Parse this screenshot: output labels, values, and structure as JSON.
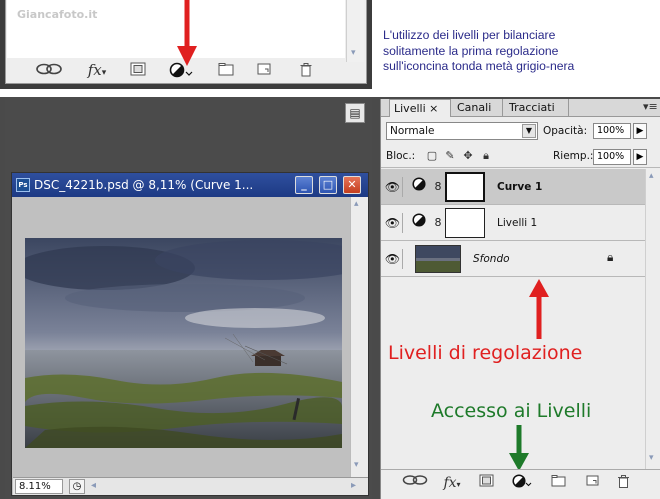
{
  "top_panel": {
    "watermark": "Giancafoto.it",
    "icons": [
      "link-icon",
      "fx-icon",
      "mask-icon",
      "adjustment-icon",
      "folder-icon",
      "new-layer-icon",
      "trash-icon"
    ],
    "fx_label": "fx"
  },
  "paragraph": {
    "lines": [
      "L'utilizzo dei livelli per bilanciare",
      "solitamente la prima regolazione",
      "sull'iconcina tonda metà grigio-nera"
    ],
    "color": "#2b2b8a"
  },
  "document": {
    "title": "DSC_4221b.psd @ 8,11% (Curve 1...",
    "zoom": "8.11%"
  },
  "layers_panel": {
    "tabs": [
      {
        "label": "Livelli ×",
        "active": true
      },
      {
        "label": "Canali",
        "active": false
      },
      {
        "label": "Tracciati",
        "active": false
      }
    ],
    "blend_mode": "Normale",
    "opacity_label": "Opacità:",
    "opacity_value": "100%",
    "lock_label": "Bloc.:",
    "fill_label": "Riemp.:",
    "fill_value": "100%",
    "layers": [
      {
        "name": "Curve 1",
        "type": "adjustment",
        "bold": true
      },
      {
        "name": "Livelli 1",
        "type": "adjustment",
        "bold": false
      },
      {
        "name": "Sfondo",
        "type": "background",
        "bold": false,
        "italic": true
      }
    ],
    "fx_label": "fx"
  },
  "annotations": {
    "red_label": "Livelli di regolazione",
    "green_label": "Accesso ai Livelli",
    "red_color": "#e02020",
    "green_color": "#1e7a2a"
  }
}
